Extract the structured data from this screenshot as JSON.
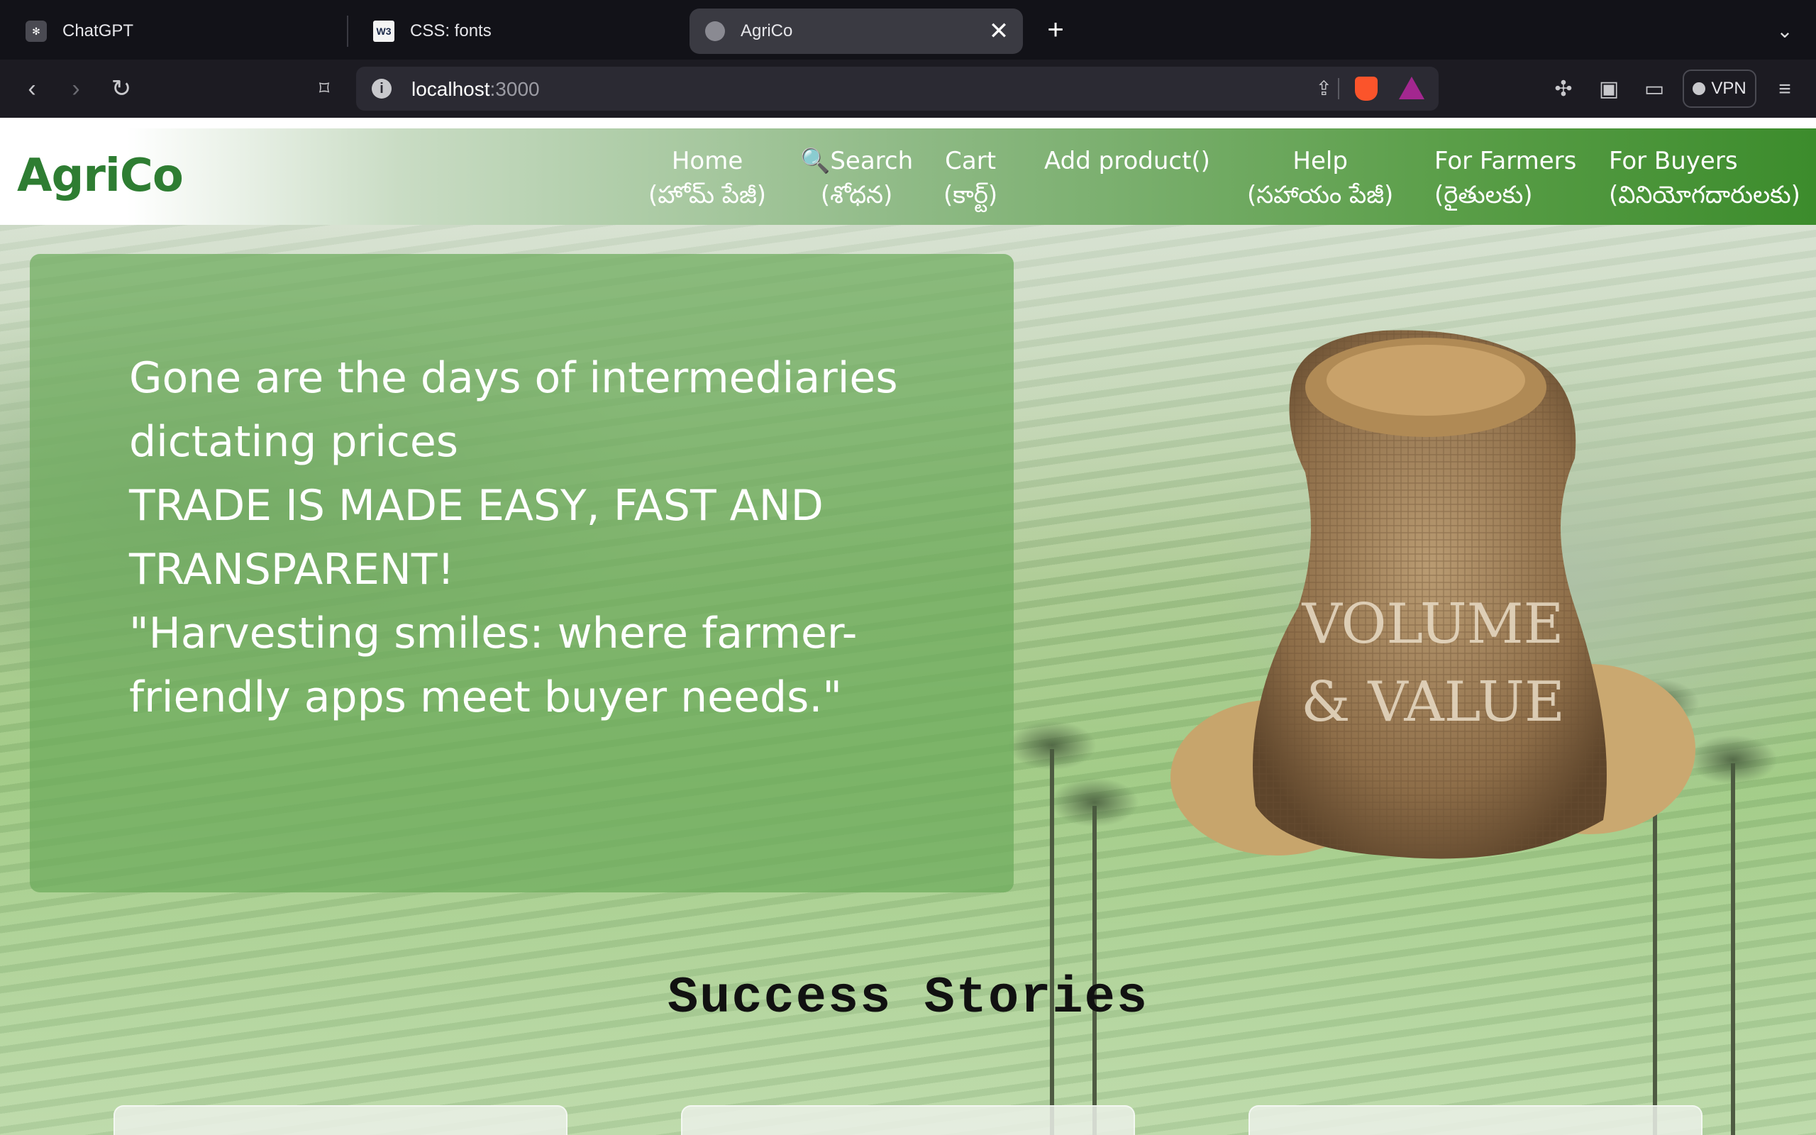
{
  "browser": {
    "tabs": [
      {
        "title": "ChatGPT",
        "icon": "chatgpt-icon",
        "active": false
      },
      {
        "title": "CSS: fonts",
        "icon": "w3schools-icon",
        "active": false
      },
      {
        "title": "AgriCo",
        "icon": "globe-icon",
        "active": true
      }
    ],
    "new_tab_label": "+",
    "close_label": "✕",
    "address": {
      "host": "localhost",
      "port": ":3000"
    },
    "vpn_label": "VPN"
  },
  "site": {
    "brand": "AgriCo",
    "nav": [
      {
        "line1": "Home",
        "line2": "(హోమ్ పేజీ)"
      },
      {
        "line1": "🔍Search",
        "line2": "(శోధన)"
      },
      {
        "line1": "Cart",
        "line2": "(కార్ట్)"
      },
      {
        "line1": "Add product()",
        "line2": ""
      },
      {
        "line1": "Help",
        "line2": "(సహాయం పేజీ)"
      },
      {
        "line1": "For Farmers",
        "line2": "(రైతులకు)"
      },
      {
        "line1": "For Buyers",
        "line2": "(వినియోగదారులకు)"
      }
    ],
    "hero": {
      "line1": "Gone are the days of intermediaries dictating prices",
      "line2": "TRADE IS MADE EASY, FAST AND TRANSPARENT!",
      "line3": "\"Harvesting smiles: where farmer-friendly apps meet buyer needs.\""
    },
    "sack_text": [
      "VOLUME",
      "& VALUE"
    ],
    "section_title": "Success Stories",
    "colors": {
      "brand": "#2e7d32",
      "nav_end": "#3c8c2c",
      "hero_card": "#6caa5c"
    }
  }
}
